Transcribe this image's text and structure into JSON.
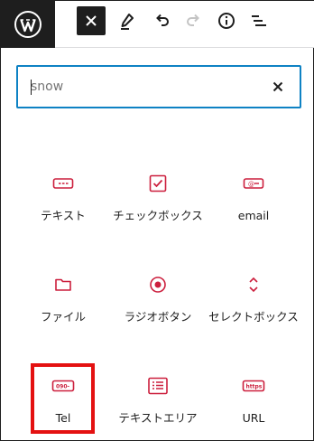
{
  "colors": {
    "accent": "#cc1f3d",
    "focus": "#0e82c4",
    "highlight": "#e41111",
    "dark": "#1e1e1e"
  },
  "toolbar": {
    "logo_icon": "wordpress-logo",
    "buttons": [
      "close-icon",
      "pencil-icon",
      "undo-icon",
      "redo-icon",
      "info-icon",
      "list-view-icon"
    ]
  },
  "search": {
    "value": "snow",
    "clear_icon": "close-icon"
  },
  "blocks": [
    {
      "label": "テキスト",
      "icon": "text-field-icon"
    },
    {
      "label": "チェックボックス",
      "icon": "checkbox-icon"
    },
    {
      "label": "email",
      "icon": "email-field-icon"
    },
    {
      "label": "ファイル",
      "icon": "folder-icon"
    },
    {
      "label": "ラジオボタン",
      "icon": "radio-button-icon"
    },
    {
      "label": "セレクトボックス",
      "icon": "select-chevrons-icon"
    },
    {
      "label": "Tel",
      "icon": "tel-field-icon",
      "icon_text": "090-",
      "highlighted": true
    },
    {
      "label": "テキストエリア",
      "icon": "textarea-icon"
    },
    {
      "label": "URL",
      "icon": "url-field-icon",
      "icon_text": "https"
    }
  ]
}
